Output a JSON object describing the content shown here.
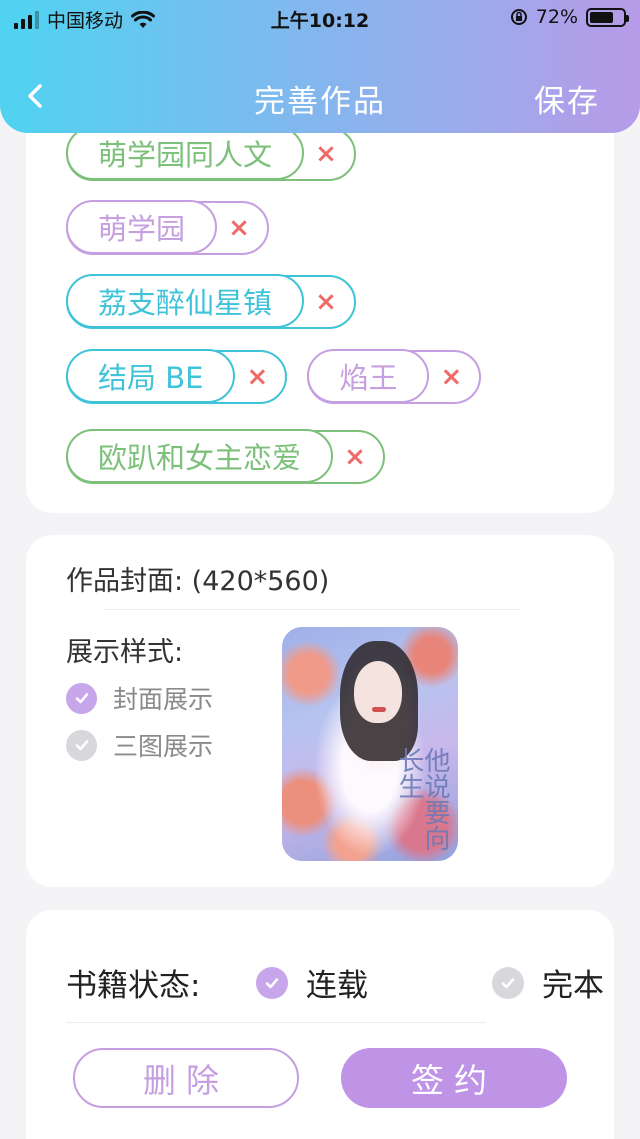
{
  "status_bar": {
    "carrier": "中国移动",
    "time": "上午10:12",
    "battery": "72%",
    "battery_level": 0.72
  },
  "nav": {
    "title": "完善作品",
    "save_label": "保存"
  },
  "tags": [
    {
      "label": "萌学园同人文",
      "color": "green",
      "remove": "×"
    },
    {
      "label": "萌学园",
      "color": "purple",
      "remove": "×"
    },
    {
      "label": "荔支醉仙星镇",
      "color": "cyan",
      "remove": "×"
    },
    {
      "label": "结局 BE",
      "color": "cyan",
      "remove": "×"
    },
    {
      "label": "焰王",
      "color": "purple",
      "remove": "×"
    },
    {
      "label": "欧趴和女主恋爱",
      "color": "green",
      "remove": "×"
    }
  ],
  "cover": {
    "title": "作品封面: (420*560)",
    "style_label": "展示样式:",
    "options": [
      {
        "label": "封面展示",
        "checked": true
      },
      {
        "label": "三图展示",
        "checked": false
      }
    ],
    "image_text": "他说要向长生"
  },
  "book_status": {
    "label": "书籍状态:",
    "options": [
      {
        "label": "连载",
        "checked": true
      },
      {
        "label": "完本",
        "checked": false
      }
    ]
  },
  "actions": {
    "delete_label": "删除",
    "sign_label": "签约"
  },
  "colors": {
    "accent_purple": "#c59fe0",
    "tag_green": "#7cc07a",
    "tag_cyan": "#3fc3d8",
    "remove_red": "#f06a6a"
  }
}
